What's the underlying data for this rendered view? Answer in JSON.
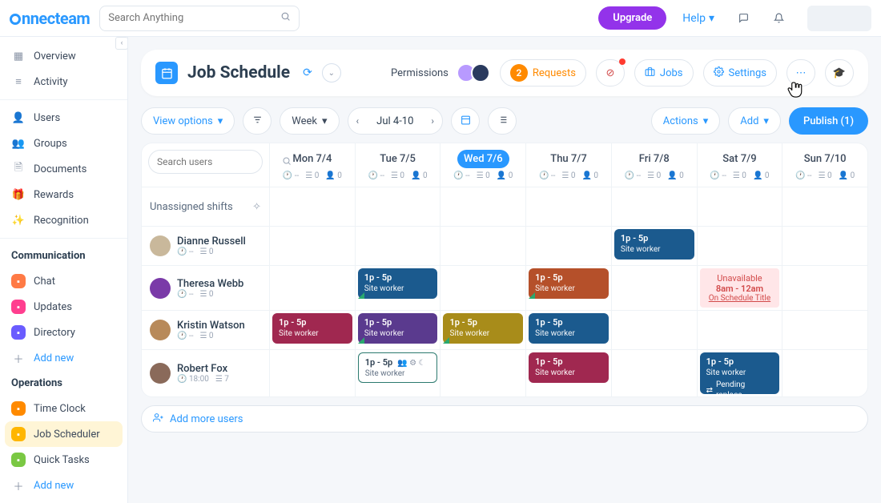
{
  "top": {
    "logo": "connecteam",
    "search_placeholder": "Search Anything",
    "upgrade": "Upgrade",
    "help": "Help"
  },
  "sidebar": {
    "main": [
      {
        "icon": "grid",
        "label": "Overview"
      },
      {
        "icon": "list",
        "label": "Activity"
      }
    ],
    "admin": [
      {
        "icon": "user",
        "label": "Users"
      },
      {
        "icon": "users",
        "label": "Groups"
      },
      {
        "icon": "doc",
        "label": "Documents"
      },
      {
        "icon": "gift",
        "label": "Rewards"
      },
      {
        "icon": "star",
        "label": "Recognition"
      }
    ],
    "comm_head": "Communication",
    "comm": [
      {
        "color": "#ff7a45",
        "label": "Chat"
      },
      {
        "color": "#ff3e8f",
        "label": "Updates"
      },
      {
        "color": "#6a5cff",
        "label": "Directory"
      }
    ],
    "add_new": "Add new",
    "ops_head": "Operations",
    "ops": [
      {
        "color": "#ff8a00",
        "label": "Time Clock",
        "active": false
      },
      {
        "color": "#ffb600",
        "label": "Job Scheduler",
        "active": true
      },
      {
        "color": "#7ac843",
        "label": "Quick Tasks",
        "active": false
      }
    ]
  },
  "header": {
    "title": "Job Schedule",
    "permissions": "Permissions",
    "requests_count": "2",
    "requests": "Requests",
    "jobs": "Jobs",
    "settings": "Settings"
  },
  "toolbar": {
    "view_options": "View options",
    "period": "Week",
    "range": "Jul 4-10",
    "actions": "Actions",
    "add": "Add",
    "publish": "Publish (1)"
  },
  "schedule": {
    "search_placeholder": "Search users",
    "unassigned": "Unassigned shifts",
    "days": [
      {
        "label": "Mon 7/4"
      },
      {
        "label": "Tue 7/5"
      },
      {
        "label": "Wed 7/6",
        "active": true
      },
      {
        "label": "Thu 7/7"
      },
      {
        "label": "Fri 7/8"
      },
      {
        "label": "Sat 7/9"
      },
      {
        "label": "Sun 7/10"
      }
    ],
    "meta_zero": "0",
    "meta_dash": "--",
    "users": [
      {
        "name": "Dianne Russell",
        "clock": "--",
        "list": "0",
        "av": "#c9b89b"
      },
      {
        "name": "Theresa Webb",
        "clock": "--",
        "list": "0",
        "av": "#7a3aa8"
      },
      {
        "name": "Kristin Watson",
        "clock": "--",
        "list": "0",
        "av": "#b88a5a"
      },
      {
        "name": "Robert Fox",
        "clock": "18:00",
        "list": "7",
        "av": "#8a6a5a"
      }
    ],
    "shift_time": "1p - 5p",
    "shift_role": "Site worker",
    "unavailable": {
      "title": "Unavailable",
      "hours": "8am - 12am",
      "link": "On Schedule Title"
    },
    "pending": "Pending replace",
    "add_more": "Add more users"
  }
}
